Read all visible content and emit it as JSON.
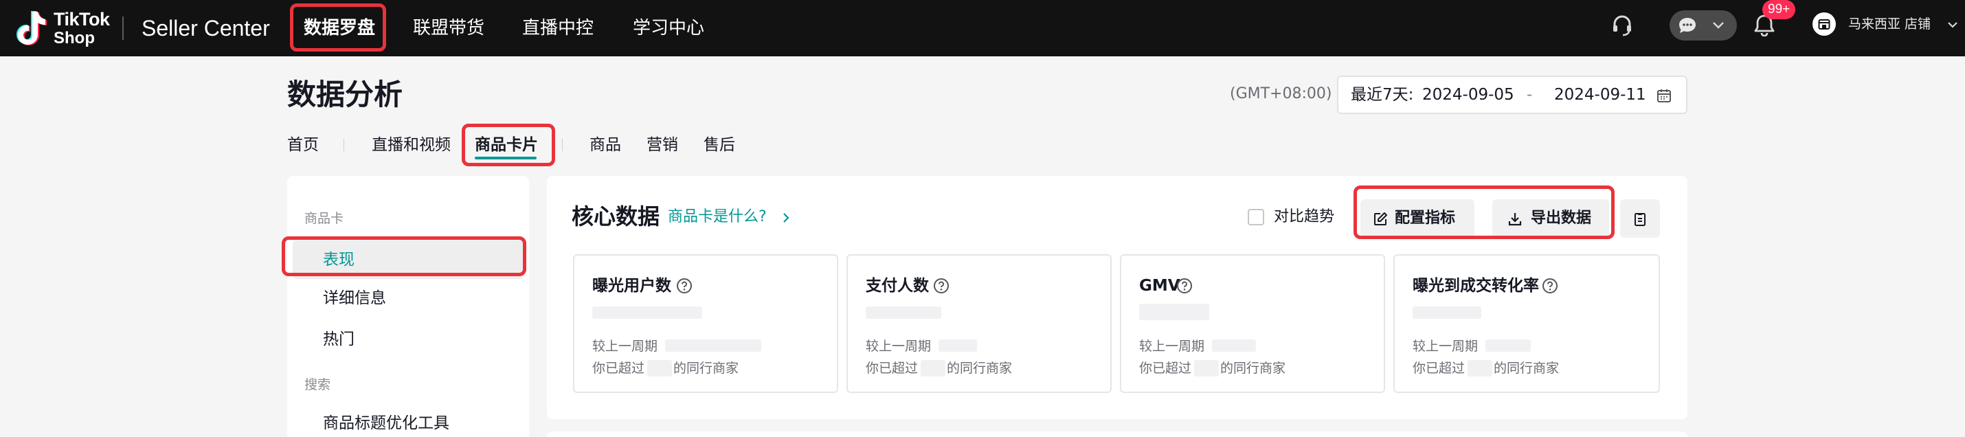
{
  "brand": {
    "logo_line1": "TikTok",
    "logo_line2": "Shop",
    "product": "Seller Center"
  },
  "top_nav": [
    {
      "label": "数据罗盘",
      "active": true
    },
    {
      "label": "联盟带货",
      "active": false
    },
    {
      "label": "直播中控",
      "active": false
    },
    {
      "label": "学习中心",
      "active": false
    }
  ],
  "header_right": {
    "notification_badge": "99+",
    "shop_name": "马来西亚 店铺",
    "icons": [
      "headset-icon",
      "chat-bubble-icon",
      "chevron-down-icon",
      "bell-icon",
      "shop-avatar-icon"
    ]
  },
  "page": {
    "title": "数据分析",
    "timezone": "(GMT+08:00)",
    "date_range": {
      "preset": "最近7天:",
      "start": "2024-09-05",
      "separator": "-",
      "end": "2024-09-11"
    }
  },
  "tabs": [
    {
      "label": "首页",
      "active": false
    },
    {
      "label": "直播和视频",
      "active": false
    },
    {
      "label": "商品卡片",
      "active": true
    },
    {
      "label": "商品",
      "active": false
    },
    {
      "label": "营销",
      "active": false
    },
    {
      "label": "售后",
      "active": false
    }
  ],
  "sidebar": {
    "groups": [
      {
        "label": "商品卡",
        "items": [
          {
            "label": "表现",
            "active": true
          },
          {
            "label": "详细信息",
            "active": false
          },
          {
            "label": "热门",
            "active": false
          }
        ]
      },
      {
        "label": "搜索",
        "items": [
          {
            "label": "商品标题优化工具",
            "active": false
          }
        ]
      }
    ]
  },
  "core": {
    "title": "核心数据",
    "help_link": "商品卡是什么?",
    "compare_label": "对比趋势",
    "compare_checked": false,
    "configure_button": "配置指标",
    "export_button": "导出数据",
    "metrics": [
      {
        "title": "曝光用户数",
        "compare_label": "较上一周期",
        "peer_prefix": "你已超过",
        "peer_suffix": "的同行商家"
      },
      {
        "title": "支付人数",
        "compare_label": "较上一周期",
        "peer_prefix": "你已超过",
        "peer_suffix": "的同行商家"
      },
      {
        "title": "GMV",
        "compare_label": "较上一周期",
        "peer_prefix": "你已超过",
        "peer_suffix": "的同行商家"
      },
      {
        "title": "曝光到成交转化率",
        "compare_label": "较上一周期",
        "peer_prefix": "你已超过",
        "peer_suffix": "的同行商家"
      }
    ]
  },
  "colors": {
    "topbar": "#121212",
    "accent_teal": "#009995",
    "highlight_red": "#e9333b",
    "badge": "#fe2c55"
  }
}
